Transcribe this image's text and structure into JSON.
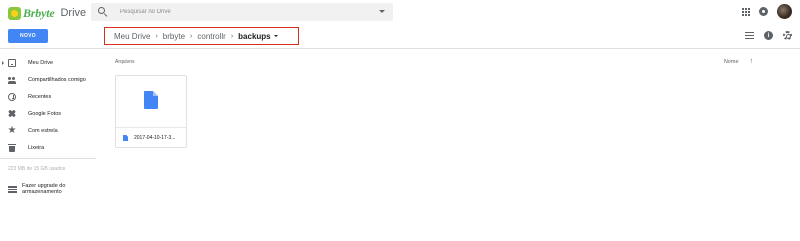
{
  "header": {
    "brand_text": "Brbyte",
    "product": "Drive",
    "search_placeholder": "Pesquisar no Drive"
  },
  "toolbar": {
    "new_label": "NOVO",
    "breadcrumb": [
      "Meu Drive",
      "brbyte",
      "controllr",
      "backups"
    ]
  },
  "sidebar": {
    "items": [
      {
        "label": "Meu Drive",
        "icon": "drive-icon"
      },
      {
        "label": "Compartilhados comigo",
        "icon": "shared-icon"
      },
      {
        "label": "Recentes",
        "icon": "clock-icon"
      },
      {
        "label": "Google Fotos",
        "icon": "photos-icon"
      },
      {
        "label": "Com estrela",
        "icon": "star-icon"
      },
      {
        "label": "Lixeira",
        "icon": "trash-icon"
      }
    ],
    "storage": "223 MB de 15 GB usados",
    "upgrade_label": "Fazer upgrade do armazenamento"
  },
  "main": {
    "section_label": "Arquivos",
    "sort_label": "Nome",
    "sort_arrow": "↑",
    "files": [
      {
        "name": "2017-04-10-17-3...",
        "icon": "document-icon"
      }
    ]
  },
  "colors": {
    "accent": "#4285f4",
    "highlight_border": "#d92d20"
  }
}
